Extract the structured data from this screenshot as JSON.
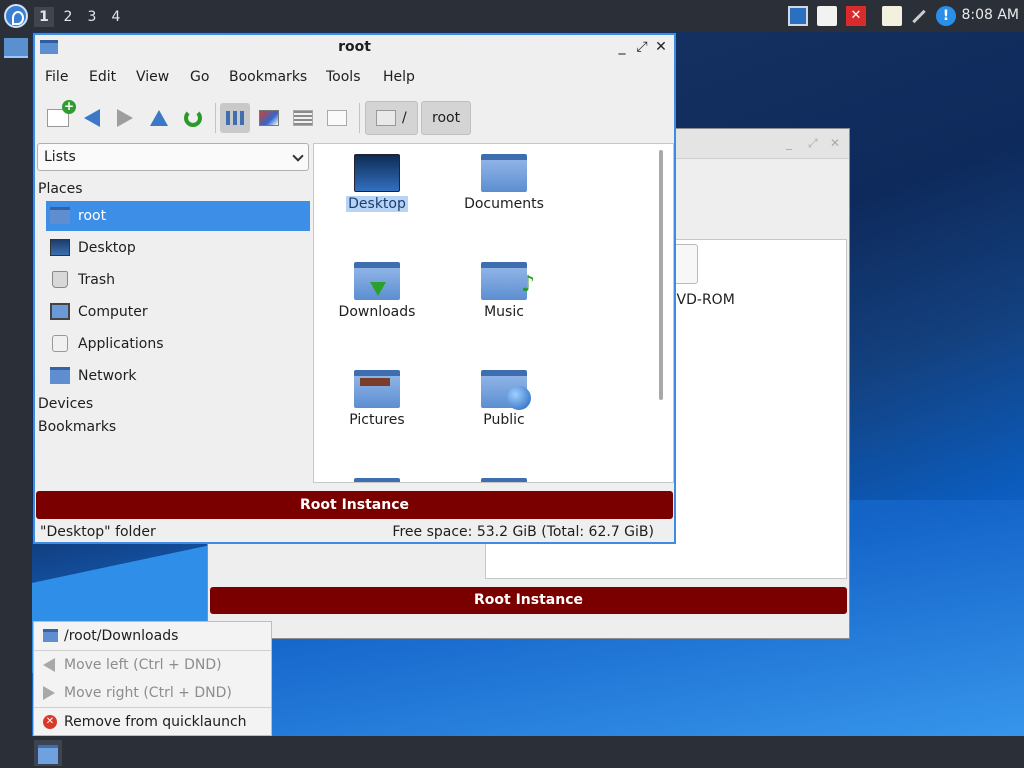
{
  "top_panel": {
    "workspaces": [
      "1",
      "2",
      "3",
      "4"
    ],
    "active_workspace": "1",
    "clock": "8:08 AM",
    "tray_icons": [
      "display-icon",
      "notes-icon",
      "close-app-icon",
      "clipboard-icon",
      "network-icon",
      "info-icon"
    ]
  },
  "background_window": {
    "drive_label": "DVD-ROM",
    "banner": "Root Instance"
  },
  "window": {
    "title": "root",
    "menu": [
      "File",
      "Edit",
      "View",
      "Go",
      "Bookmarks",
      "Tools",
      "Help"
    ],
    "breadcrumbs": [
      "/",
      "root"
    ],
    "side_pane": {
      "mode": "Lists",
      "places_header": "Places",
      "places": [
        "root",
        "Desktop",
        "Trash",
        "Computer",
        "Applications",
        "Network"
      ],
      "selected_place": "root",
      "devices_header": "Devices",
      "bookmarks_header": "Bookmarks"
    },
    "files": [
      "Desktop",
      "Documents",
      "Downloads",
      "Music",
      "Pictures",
      "Public"
    ],
    "selected_file": "Desktop",
    "banner": "Root Instance",
    "status_left": "\"Desktop\" folder",
    "status_right": "Free space: 53.2 GiB (Total: 62.7 GiB)"
  },
  "popup_menu": {
    "items": [
      {
        "label": "/root/Downloads",
        "enabled": true
      },
      {
        "label": "Move left (Ctrl + DND)",
        "enabled": false
      },
      {
        "label": "Move right (Ctrl + DND)",
        "enabled": false
      },
      {
        "label": "Remove from quicklaunch",
        "enabled": true
      }
    ]
  },
  "colors": {
    "accent": "#3d8ee6",
    "root_banner": "#7a0000",
    "panel": "#2a2f38"
  }
}
